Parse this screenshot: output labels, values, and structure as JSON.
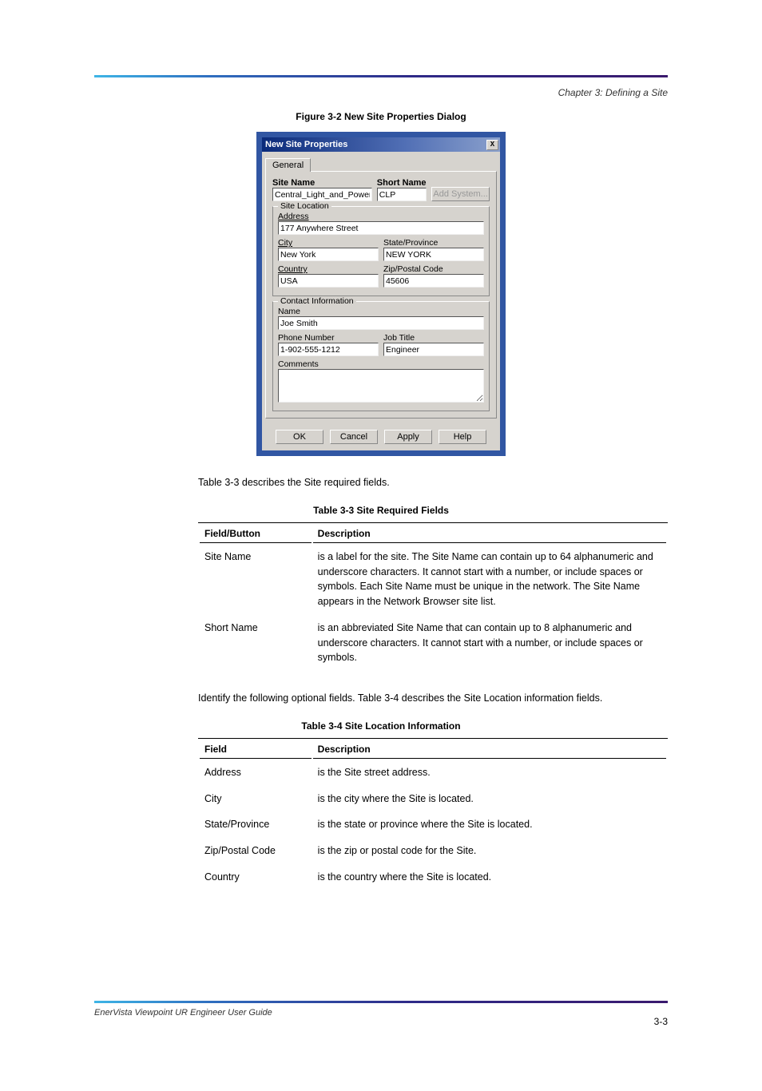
{
  "header": {
    "chapter": "Chapter 3: Defining a Site"
  },
  "figure": {
    "caption": "Figure 3-2 New Site Properties Dialog"
  },
  "dialog": {
    "title": "New Site Properties",
    "close": "X",
    "tab": "General",
    "labels": {
      "site_name": "Site Name",
      "short_name": "Short Name",
      "add_system": "Add System...",
      "site_location": "Site Location",
      "address": "Address",
      "city": "City",
      "state": "State/Province",
      "country": "Country",
      "zip": "Zip/Postal Code",
      "contact_info": "Contact Information",
      "name": "Name",
      "phone": "Phone Number",
      "job": "Job Title",
      "comments": "Comments"
    },
    "values": {
      "site_name": "Central_Light_and_Power",
      "short_name": "CLP",
      "address": "177 Anywhere Street",
      "city": "New York",
      "state": "NEW YORK",
      "country": "USA",
      "zip": "45606",
      "name": "Joe Smith",
      "phone": "1-902-555-1212",
      "job": "Engineer",
      "comments": ""
    },
    "buttons": {
      "ok": "OK",
      "cancel": "Cancel",
      "apply": "Apply",
      "help": "Help"
    }
  },
  "para1": "Table 3-3 describes the Site required fields.",
  "table1": {
    "caption": "Table 3-3 Site Required Fields",
    "head": {
      "c1": "Field/Button",
      "c2": "Description"
    },
    "rows": [
      {
        "c1": "Site Name",
        "c2": "is a label for the site. The Site Name can contain up to 64 alphanumeric and underscore characters. It cannot start with a number, or include spaces or symbols. Each Site Name must be unique in the network. The Site Name appears in the Network Browser site list."
      },
      {
        "c1": "Short Name",
        "c2": "is an abbreviated Site Name that can contain up to 8 alphanumeric and underscore characters. It cannot start with a number, or include spaces or symbols."
      }
    ]
  },
  "para2": "Identify the following optional fields. Table 3-4 describes the Site Location information fields.",
  "table2": {
    "caption": "Table 3-4 Site Location Information",
    "head": {
      "c1": "Field",
      "c2": "Description"
    },
    "rows": [
      {
        "c1": "Address",
        "c2": "is the Site street address."
      },
      {
        "c1": "City",
        "c2": "is the city where the Site is located."
      },
      {
        "c1": "State/Province",
        "c2": "is the state or province where the Site is located."
      },
      {
        "c1": "Zip/Postal Code",
        "c2": "is the zip or postal code for the Site."
      },
      {
        "c1": "Country",
        "c2": "is the country where the Site is located."
      }
    ]
  },
  "footer": {
    "text": "EnerVista Viewpoint UR Engineer User Guide",
    "page": "3-3"
  }
}
